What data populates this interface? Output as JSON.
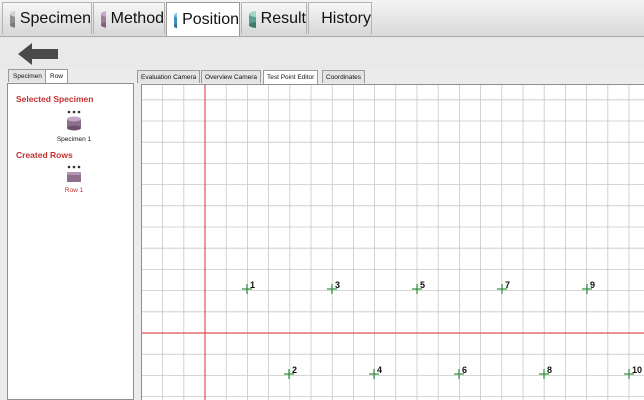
{
  "main_tabs": [
    {
      "label": "Specimen",
      "icon": "specimen-cylinder-icon",
      "active": false
    },
    {
      "label": "Method",
      "icon": "method-cylinder-icon",
      "active": false
    },
    {
      "label": "Position",
      "icon": "position-cylinder-icon",
      "active": true
    },
    {
      "label": "Result",
      "icon": "result-cylinder-icon",
      "active": false
    },
    {
      "label": "History",
      "icon": "history-icon",
      "active": false
    }
  ],
  "toolbar": {
    "back_icon": "back-arrow-icon"
  },
  "panel_tabs": [
    {
      "label": "Specimen",
      "active": false
    },
    {
      "label": "Row",
      "active": true
    }
  ],
  "left_panel": {
    "selected_specimen": {
      "heading": "Selected Specimen",
      "item_label": "Specimen 1",
      "icon": "specimen-icon"
    },
    "created_rows": {
      "heading": "Created Rows",
      "item_label": "Row 1",
      "icon": "row-icon"
    }
  },
  "view_tabs": [
    {
      "label": "Evaluation Camera",
      "active": false
    },
    {
      "label": "Overview Camera",
      "active": false
    },
    {
      "label": "Test Point Editor",
      "active": true
    },
    {
      "label": "Coordinates",
      "active": false
    }
  ],
  "editor": {
    "axis_color": "#e05050",
    "grid_color": "#c8c8c8",
    "point_color": "#2e8b3a",
    "test_points": [
      "1",
      "2",
      "3",
      "4",
      "5",
      "6",
      "7",
      "8",
      "9",
      "10"
    ]
  }
}
